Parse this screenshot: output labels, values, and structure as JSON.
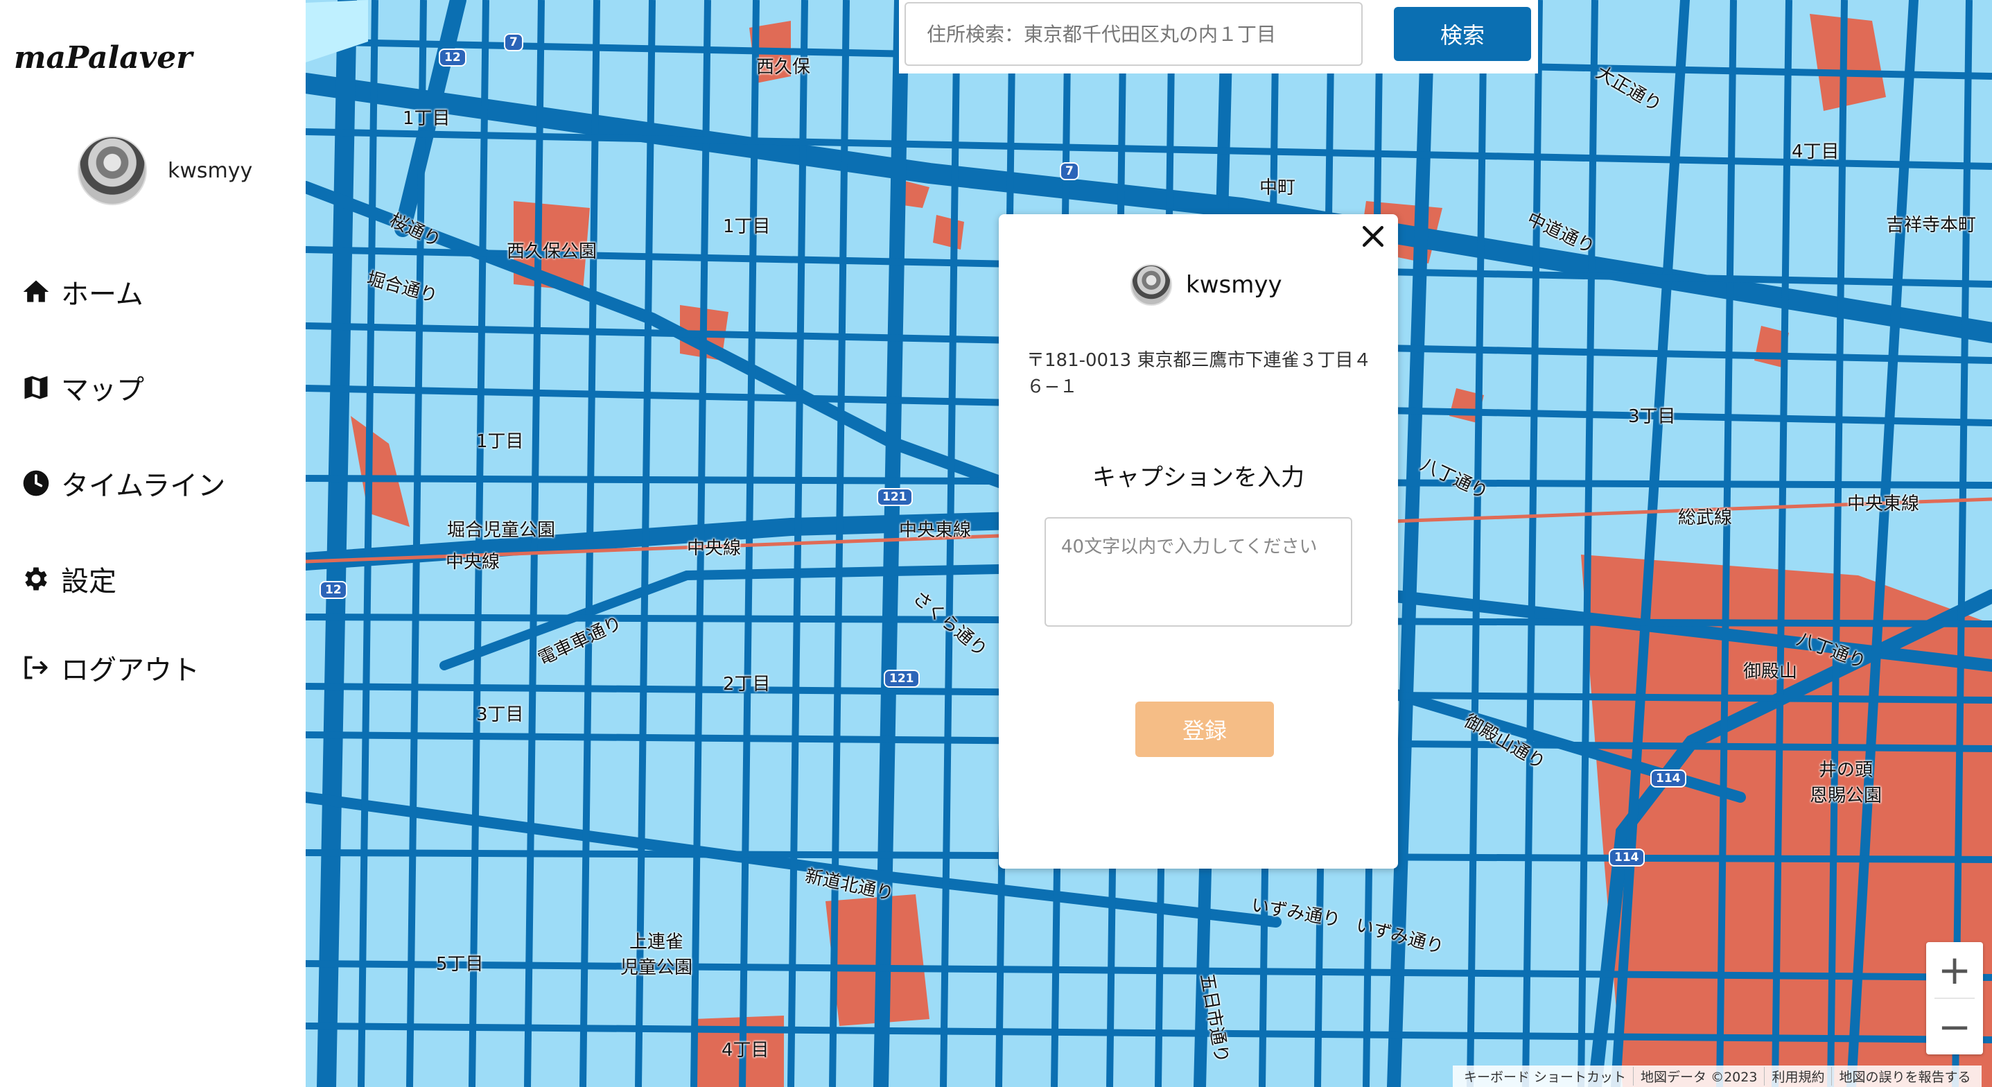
{
  "app": {
    "logo": "maPalaver"
  },
  "profile": {
    "username": "kwsmyy"
  },
  "nav": {
    "items": [
      {
        "label": "ホーム",
        "icon": "home-icon"
      },
      {
        "label": "マップ",
        "icon": "map-icon"
      },
      {
        "label": "タイムライン",
        "icon": "clock-icon"
      },
      {
        "label": "設定",
        "icon": "gear-icon"
      },
      {
        "label": "ログアウト",
        "icon": "logout-icon"
      }
    ]
  },
  "search": {
    "placeholder": "住所検索：東京都千代田区丸の内１丁目",
    "button_label": "検索"
  },
  "modal": {
    "username": "kwsmyy",
    "address": "〒181-0013 東京都三鷹市下連雀３丁目４６−１",
    "caption_title": "キャプションを入力",
    "caption_placeholder": "40文字以内で入力してください",
    "register_label": "登録"
  },
  "map": {
    "labels": {
      "nishikubo": "西久保",
      "chome1_a": "1丁目",
      "chome1_b": "1丁目",
      "chome1_c": "1丁目",
      "nishikubo_park": "西久保公園",
      "sakura_dori": "桜通り",
      "horiai_dori": "堀合通り",
      "horiai_park": "堀合児童公園",
      "chuo_line_a": "中央線",
      "chuo_line_b": "中央線",
      "chuo_tosen_a": "中央東線",
      "chuo_tosen_b": "中央東線",
      "densha_dori": "電車車通り",
      "chome2": "2丁目",
      "chome3_a": "3丁目",
      "chome3_b": "3丁目",
      "chome4_a": "4丁目",
      "chome4_b": "4丁目",
      "chome5": "5丁目",
      "kamirenjaku_park": "上連雀\n児童公園",
      "shindo_kita_dori": "新道北通り",
      "nakacho": "中町",
      "kichijoji_honcho": "吉祥寺本町",
      "taisho_dori": "大正通り",
      "nakamichi_dori": "中道通り",
      "hacchome_dori_a": "八丁通り",
      "hacchome_dori_b": "八丁通り",
      "sobu_line": "総武線",
      "goten_yama": "御殿山",
      "goten_yama_dori": "御殿山通り",
      "inokashira_park": "井の頭\n恩賜公園",
      "izumi_dori_a": "いずみ通り",
      "izumi_dori_b": "いずみ通り",
      "sakura_dori_b": "さくら通り",
      "itsukaichi_dori": "五日市通り"
    },
    "routes": [
      "12",
      "7",
      "121",
      "121",
      "7",
      "12",
      "114",
      "114"
    ]
  },
  "zoom": {
    "in": "+",
    "out": "−"
  },
  "attribution": {
    "shortcuts": "キーボード ショートカット",
    "map_data": "地図データ ©2023",
    "terms": "利用規約",
    "report": "地図の誤りを報告する"
  },
  "colors": {
    "map_water": "#9ddcf7",
    "map_road": "#0b6fb2",
    "map_park": "#e06b56",
    "primary": "#0b6fb2",
    "register_disabled": "#f5bd86"
  }
}
